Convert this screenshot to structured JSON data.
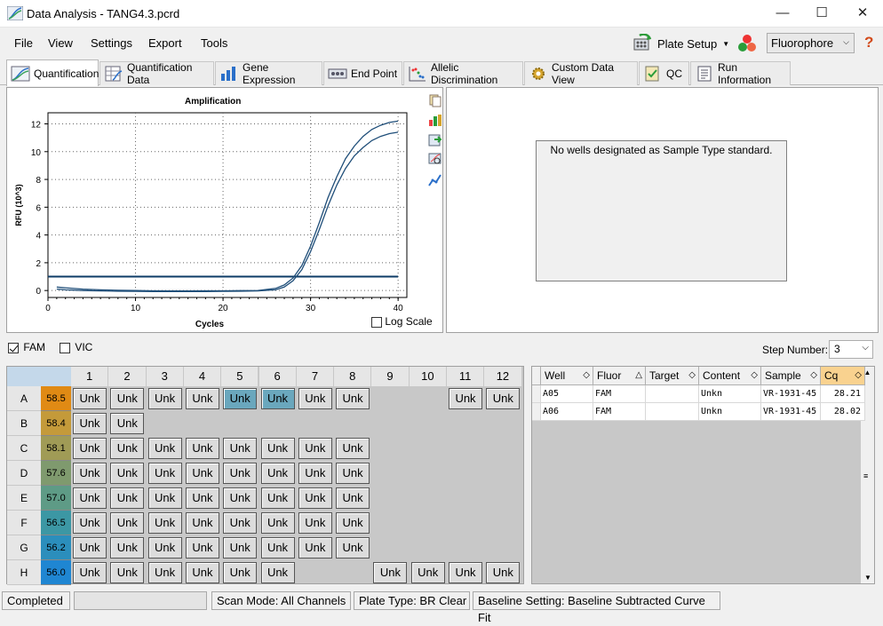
{
  "window": {
    "title": "Data Analysis - TANG4.3.pcrd",
    "minimize": "—",
    "maximize": "☐",
    "close": "✕"
  },
  "menu": {
    "file": "File",
    "view": "View",
    "settings": "Settings",
    "export": "Export",
    "tools": "Tools"
  },
  "toolbar": {
    "plate_setup": "Plate Setup",
    "fluorophore": "Fluorophore",
    "help": "?"
  },
  "tabs": [
    "Quantification",
    "Quantification Data",
    "Gene Expression",
    "End Point",
    "Allelic Discrimination",
    "Custom Data View",
    "QC",
    "Run Information"
  ],
  "chart_data": {
    "type": "line",
    "title": "Amplification",
    "xlabel": "Cycles",
    "ylabel": "RFU (10^3)",
    "xlim": [
      0,
      41
    ],
    "ylim": [
      -0.5,
      12.8
    ],
    "xticks": [
      0,
      10,
      20,
      30,
      40
    ],
    "yticks": [
      0,
      2,
      4,
      6,
      8,
      10,
      12
    ],
    "grid": true,
    "threshold": 1.0,
    "series": [
      {
        "well": "A05",
        "x": [
          1,
          2,
          4,
          6,
          8,
          10,
          12,
          14,
          16,
          18,
          20,
          22,
          24,
          26,
          27,
          28,
          29,
          30,
          31,
          32,
          33,
          34,
          35,
          36,
          37,
          38,
          39,
          40
        ],
        "y": [
          0.25,
          0.2,
          0.1,
          0.05,
          0.02,
          0.0,
          -0.02,
          -0.03,
          -0.03,
          -0.02,
          -0.02,
          -0.01,
          0.0,
          0.15,
          0.4,
          0.9,
          1.8,
          3.2,
          4.9,
          6.7,
          8.2,
          9.5,
          10.4,
          11.1,
          11.6,
          11.9,
          12.1,
          12.2
        ]
      },
      {
        "well": "A06",
        "x": [
          1,
          2,
          4,
          6,
          8,
          10,
          12,
          14,
          16,
          18,
          20,
          22,
          24,
          26,
          27,
          28,
          29,
          30,
          31,
          32,
          33,
          34,
          35,
          36,
          37,
          38,
          39,
          40
        ],
        "y": [
          0.1,
          0.05,
          0.0,
          -0.03,
          -0.05,
          -0.06,
          -0.07,
          -0.08,
          -0.08,
          -0.07,
          -0.06,
          -0.05,
          -0.03,
          0.05,
          0.25,
          0.7,
          1.5,
          2.8,
          4.4,
          6.1,
          7.6,
          8.8,
          9.7,
          10.3,
          10.8,
          11.1,
          11.3,
          11.4
        ]
      }
    ],
    "line_color": "#1f4e79",
    "threshold_color": "#0c3b66"
  },
  "log_scale": "Log Scale",
  "standard_msg": "No wells designated as Sample Type standard.",
  "filters": {
    "fam": "FAM",
    "vic": "VIC",
    "step_label": "Step Number:",
    "step_value": "3"
  },
  "plate": {
    "columns": [
      "1",
      "2",
      "3",
      "4",
      "5",
      "6",
      "7",
      "8",
      "9",
      "10",
      "11",
      "12"
    ],
    "rows": [
      {
        "label": "A",
        "temp": "58.5",
        "color": "#e08a14",
        "wells": [
          "Unk",
          "Unk",
          "Unk",
          "Unk",
          "Unk",
          "Unk",
          "Unk",
          "Unk",
          "",
          "",
          "Unk",
          "Unk"
        ],
        "selected": [
          4,
          5
        ]
      },
      {
        "label": "B",
        "temp": "58.4",
        "color": "#c49a3a",
        "wells": [
          "Unk",
          "Unk",
          "",
          "",
          "",
          "",
          "",
          "",
          "",
          "",
          "",
          ""
        ],
        "selected": []
      },
      {
        "label": "C",
        "temp": "58.1",
        "color": "#a09b56",
        "wells": [
          "Unk",
          "Unk",
          "Unk",
          "Unk",
          "Unk",
          "Unk",
          "Unk",
          "Unk",
          "",
          "",
          "",
          ""
        ],
        "selected": []
      },
      {
        "label": "D",
        "temp": "57.6",
        "color": "#7f9a6e",
        "wells": [
          "Unk",
          "Unk",
          "Unk",
          "Unk",
          "Unk",
          "Unk",
          "Unk",
          "Unk",
          "",
          "",
          "",
          ""
        ],
        "selected": []
      },
      {
        "label": "E",
        "temp": "57.0",
        "color": "#5e9b86",
        "wells": [
          "Unk",
          "Unk",
          "Unk",
          "Unk",
          "Unk",
          "Unk",
          "Unk",
          "Unk",
          "",
          "",
          "",
          ""
        ],
        "selected": []
      },
      {
        "label": "F",
        "temp": "56.5",
        "color": "#3c97a4",
        "wells": [
          "Unk",
          "Unk",
          "Unk",
          "Unk",
          "Unk",
          "Unk",
          "Unk",
          "Unk",
          "",
          "",
          "",
          ""
        ],
        "selected": []
      },
      {
        "label": "G",
        "temp": "56.2",
        "color": "#2b8ebc",
        "wells": [
          "Unk",
          "Unk",
          "Unk",
          "Unk",
          "Unk",
          "Unk",
          "Unk",
          "Unk",
          "",
          "",
          "",
          ""
        ],
        "selected": []
      },
      {
        "label": "H",
        "temp": "56.0",
        "color": "#1f86d2",
        "wells": [
          "Unk",
          "Unk",
          "Unk",
          "Unk",
          "Unk",
          "Unk",
          "",
          "",
          "Unk",
          "Unk",
          "Unk",
          "Unk"
        ],
        "selected": []
      }
    ]
  },
  "results": {
    "headers": [
      "Well",
      "Fluor",
      "Target",
      "Content",
      "Sample",
      "Cq"
    ],
    "sort_glyphs": [
      "◇",
      "△",
      "◇",
      "◇",
      "◇",
      "◇"
    ],
    "rows": [
      [
        "A05",
        "FAM",
        "",
        "Unkn",
        "VR-1931-45",
        "28.21"
      ],
      [
        "A06",
        "FAM",
        "",
        "Unkn",
        "VR-1931-45",
        "28.02"
      ]
    ]
  },
  "status": {
    "state": "Completed",
    "scan_mode": "Scan Mode: All Channels",
    "plate_type": "Plate Type: BR Clear",
    "baseline": "Baseline Setting: Baseline Subtracted Curve Fit"
  }
}
